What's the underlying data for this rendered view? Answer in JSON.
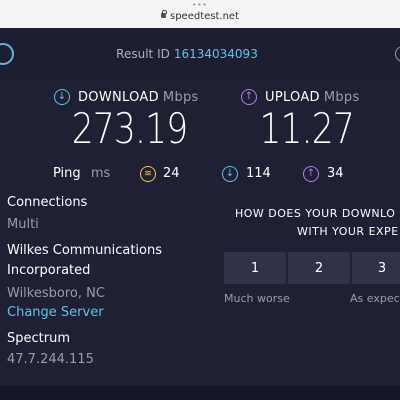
{
  "browser": {
    "menu_dots": "•••",
    "url": "speedtest.net"
  },
  "header": {
    "result_label": "Result ID",
    "result_id": "16134034093"
  },
  "download": {
    "label": "DOWNLOAD",
    "unit": "Mbps",
    "value": "273.19",
    "icon": "download-arrow-icon",
    "color": "#5bc6ec"
  },
  "upload": {
    "label": "UPLOAD",
    "unit": "Mbps",
    "value": "11.27",
    "icon": "upload-arrow-icon",
    "color": "#b07df0"
  },
  "ping": {
    "label": "Ping",
    "unit": "ms",
    "idle_value": "24",
    "download_value": "114",
    "upload_value": "34",
    "idle_color": "#f3c94d"
  },
  "connection": {
    "connections_label": "Connections",
    "connections_value": "Multi",
    "isp_line1": "Wilkes Communications",
    "isp_line2": "Incorporated",
    "location": "Wilkesboro, NC",
    "change_server": "Change Server",
    "host": "Spectrum",
    "ip": "47.7.244.115"
  },
  "survey": {
    "question_line1": "HOW DOES YOUR DOWNLO",
    "question_line2": "WITH YOUR EXPE",
    "options": [
      "1",
      "2",
      "3"
    ],
    "low_label": "Much worse",
    "mid_label": "As expect"
  }
}
